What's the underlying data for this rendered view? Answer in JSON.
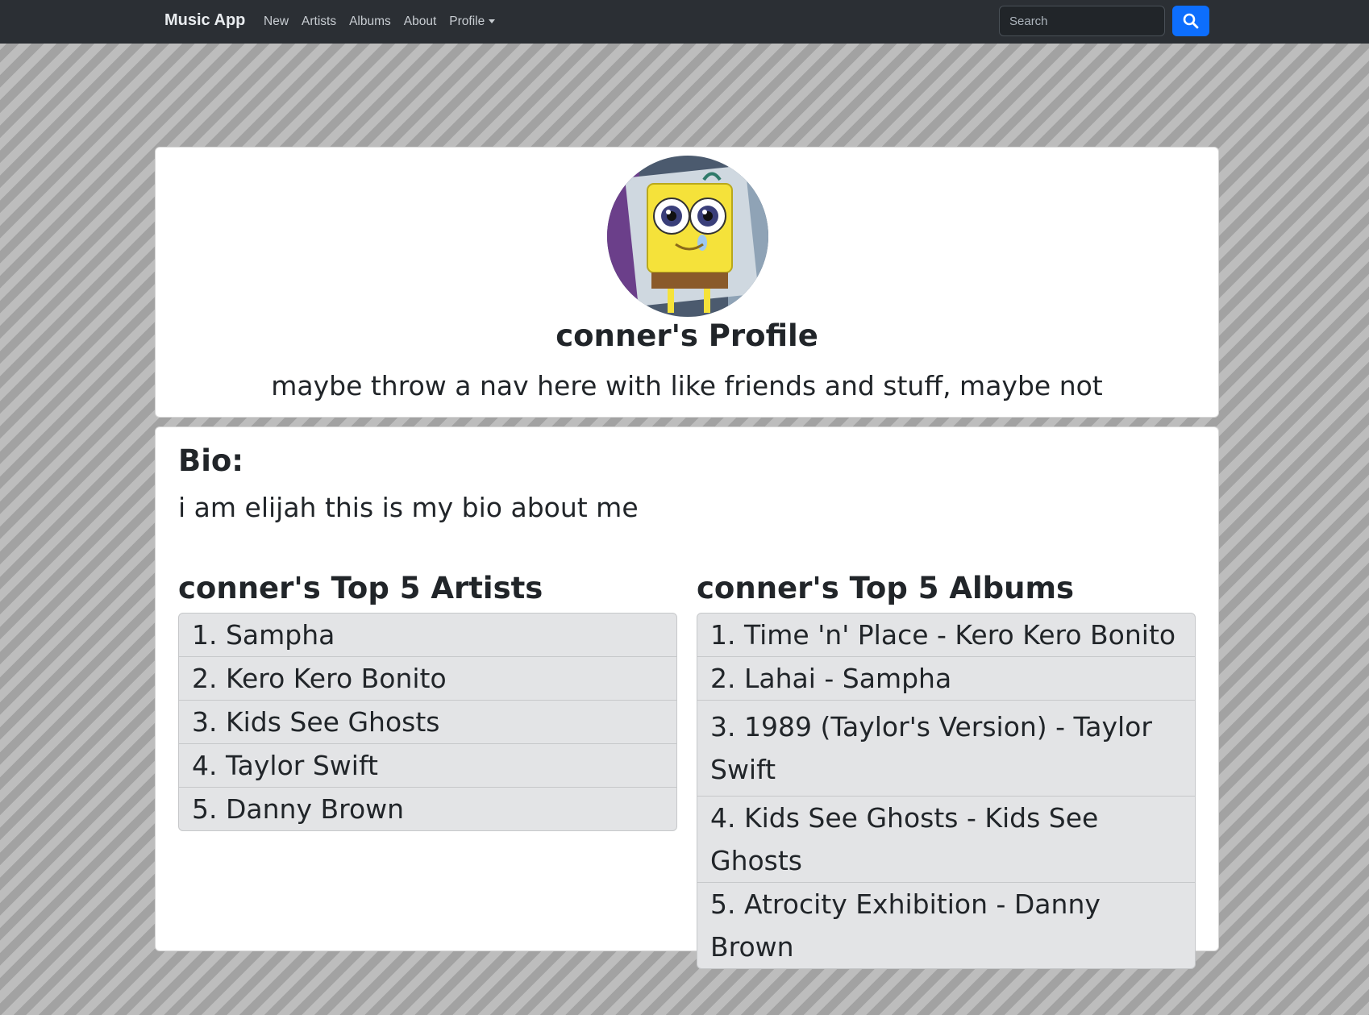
{
  "navbar": {
    "brand": "Music App",
    "links": [
      "New",
      "Artists",
      "Albums",
      "About",
      "Profile"
    ],
    "search_placeholder": "Search",
    "bg_color": "#2b2f34",
    "accent_color": "#0d6efd"
  },
  "profile": {
    "avatar_icon": "spongebob-avatar-image",
    "title": "conner's Profile",
    "subtitle": "maybe throw a nav here with like friends and stuff, maybe not"
  },
  "bio": {
    "heading": "Bio:",
    "text": "i am elijah this is my bio about me"
  },
  "artists": {
    "heading": "conner's Top 5 Artists",
    "items": [
      "1. Sampha",
      "2. Kero Kero Bonito",
      "3. Kids See Ghosts",
      "4. Taylor Swift",
      "5. Danny Brown"
    ]
  },
  "albums": {
    "heading": "conner's Top 5 Albums",
    "items": [
      "1. Time 'n' Place - Kero Kero Bonito",
      "2. Lahai - Sampha",
      "3. 1989 (Taylor's Version) - Taylor Swift",
      "4. Kids See Ghosts - Kids See Ghosts",
      "5. Atrocity Exhibition - Danny Brown"
    ]
  }
}
